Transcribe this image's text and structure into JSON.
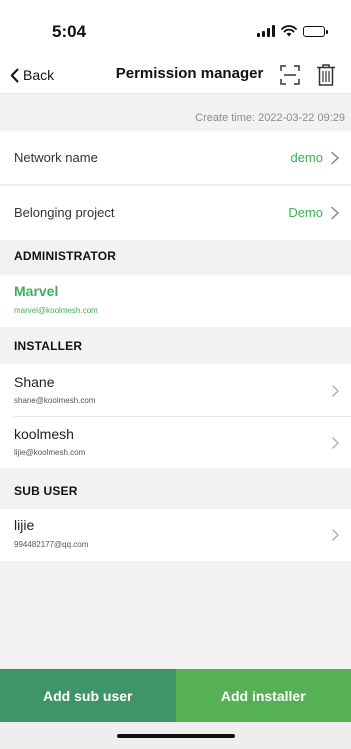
{
  "status_bar": {
    "time": "5:04",
    "battery_level": 0.7
  },
  "nav": {
    "back_label": "Back",
    "title": "Permission manager"
  },
  "create_time": "Create time: 2022-03-22 09:29",
  "network": {
    "label": "Network name",
    "value": "demo"
  },
  "project": {
    "label": "Belonging project",
    "value": "Demo"
  },
  "administrator": {
    "header": "ADMINISTRATOR",
    "name": "Marvel",
    "email": "marvel@koolmesh.com"
  },
  "installer": {
    "header": "INSTALLER",
    "users": [
      {
        "name": "Shane",
        "email": "shane@koolmesh.com"
      },
      {
        "name": "koolmesh",
        "email": "lijie@koolmesh.com"
      }
    ]
  },
  "sub_user": {
    "header": "SUB USER",
    "users": [
      {
        "name": "lijie",
        "email": "994482177@qq.com"
      }
    ]
  },
  "buttons": {
    "add_sub_user": "Add sub user",
    "add_installer": "Add installer"
  },
  "colors": {
    "accent_green": "#3fae5a",
    "sub_user_button": "#3f9468",
    "installer_button": "#55b154"
  },
  "icons": [
    "chevron-left-icon",
    "scan-icon",
    "trash-icon",
    "chevron-right-icon",
    "signal-icon",
    "wifi-icon",
    "battery-icon"
  ]
}
